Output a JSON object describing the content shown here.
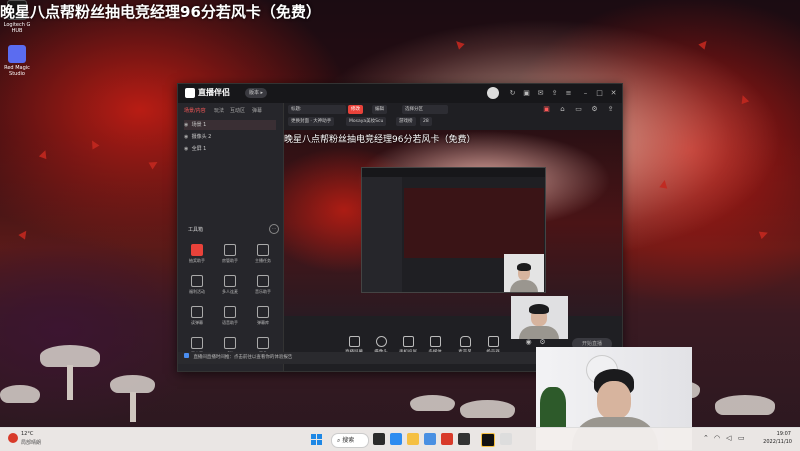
{
  "overlay_title": "晚星八点帮粉丝抽电竞经理96分若风卡（免费）",
  "desktop": {
    "icons": [
      {
        "label": "Logitech G HUB",
        "name": "logitech-ghub-desktop-icon"
      },
      {
        "label": "Red Magic Studio",
        "name": "red-magic-studio-desktop-icon"
      }
    ]
  },
  "app": {
    "title": "直播伴侣",
    "version_label": "版本 ▸",
    "left_tabs": [
      "场景/内容",
      "玩法",
      "互动区",
      "弹幕"
    ],
    "scenes": [
      {
        "label": "场景 1",
        "selected": true
      },
      {
        "label": "摄像头 2",
        "selected": false
      },
      {
        "label": "全屏 1",
        "selected": false
      }
    ],
    "tools_label": "工具箱",
    "tools_more": "···",
    "tools": [
      {
        "label": "抽奖助手",
        "highlight": true
      },
      {
        "label": "房管助手",
        "highlight": false
      },
      {
        "label": "主播任务",
        "highlight": false
      },
      {
        "label": "福利活动",
        "highlight": false
      },
      {
        "label": "多人连麦",
        "highlight": false
      },
      {
        "label": "音乐助手",
        "highlight": false
      },
      {
        "label": "读弹幕",
        "highlight": false
      },
      {
        "label": "语音助手",
        "highlight": false
      },
      {
        "label": "弹幕库",
        "highlight": false
      },
      {
        "label": "画中画",
        "highlight": false
      },
      {
        "label": "PK",
        "highlight": false
      },
      {
        "label": "更多",
        "highlight": false
      }
    ],
    "notice": "直播间直播时间推：点击前往以查看你的体验报告",
    "header_controls": {
      "title_field": "标题:",
      "red_button": "修改",
      "edit_button": "编辑",
      "category": "选择分区",
      "row2": [
        "更换封面 · 大神助手",
        "Mosaya美妆Scu",
        "游戏榜",
        "28"
      ]
    },
    "preview_title": "晚星八点帮粉丝抽电竞经理96分若风卡（免费）",
    "bottom_buttons": [
      "直播屏幕",
      "摄像头",
      "手机投屏",
      "多媒体",
      "麦克风",
      "扬声器"
    ],
    "start_button": "开始直播"
  },
  "taskbar": {
    "weather_temp": "12°C",
    "weather_desc": "局部晴朗",
    "search_label": "搜索",
    "clock_time": "19:07",
    "clock_date": "2022/11/10"
  },
  "colors": {
    "accent_red": "#e9423a",
    "app_bg": "#1f1f23",
    "taskbar_bg": "#f3eeec"
  }
}
